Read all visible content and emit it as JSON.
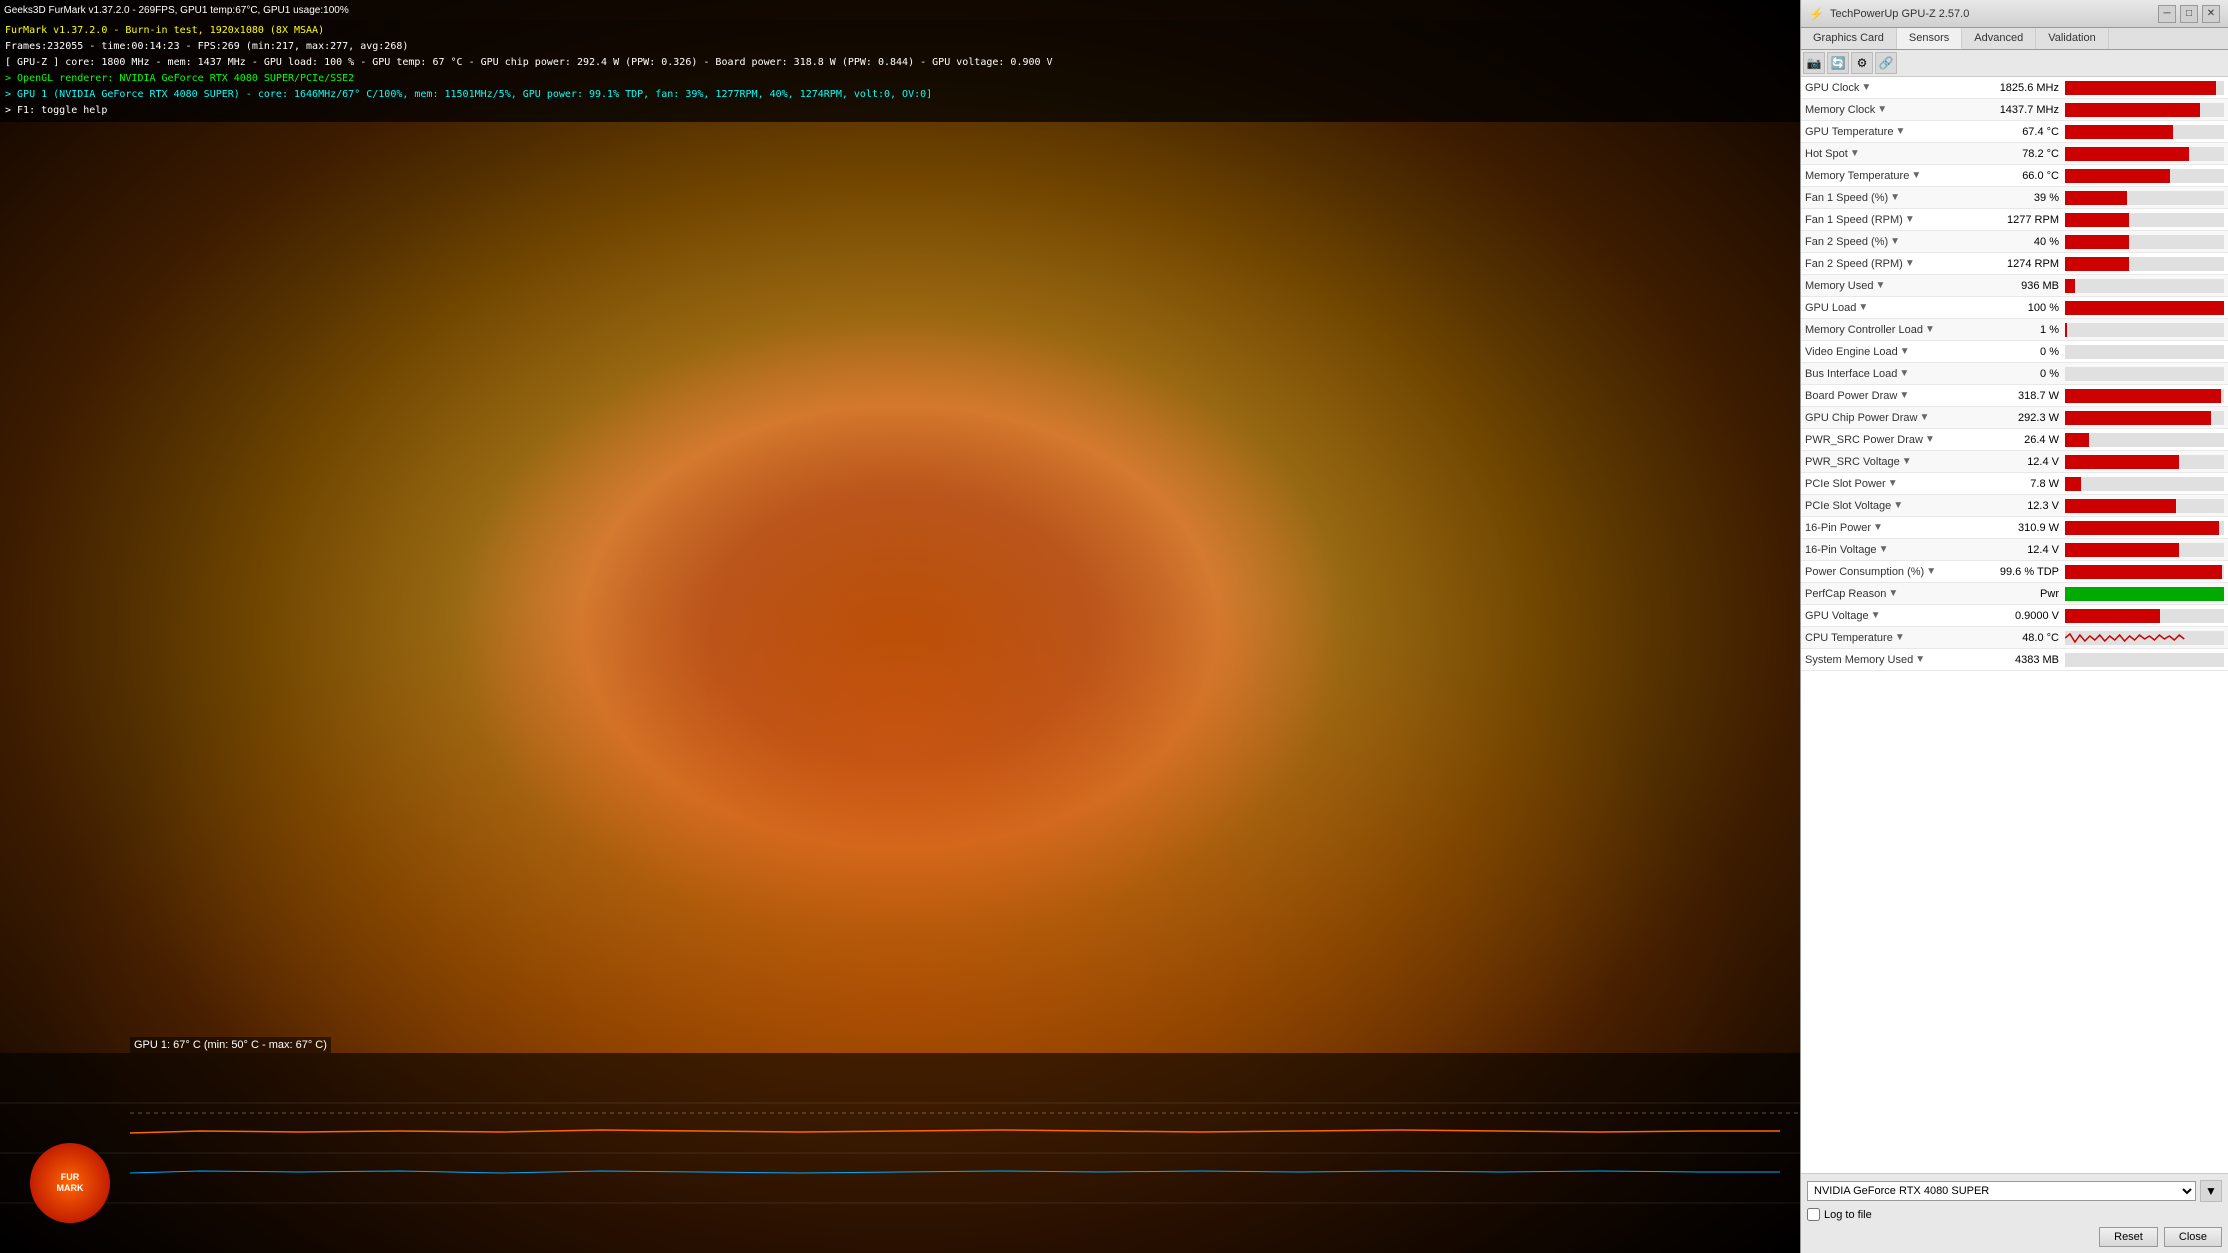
{
  "window": {
    "title": "Geeks3D FurMark v1.37.2.0 - 269FPS, GPU1 temp:67°C, GPU1 usage:100%"
  },
  "furmark": {
    "title": "FurMark v1.37.2.0 - Burn-in test, 1920x1080 (8X MSAA)",
    "stats_line1": "Frames:232055 - time:00:14:23 - FPS:269 (min:217, max:277, avg:268)",
    "stats_line2": "[ GPU-Z ] core: 1800 MHz - mem: 1437 MHz - GPU load: 100 % - GPU temp: 67 °C - GPU chip power: 292.4 W (PPW: 0.326) - Board power: 318.8 W (PPW: 0.844) - GPU voltage: 0.900 V",
    "stats_line3": "> OpenGL renderer: NVIDIA GeForce RTX 4080 SUPER/PCIe/SSE2",
    "stats_line4": "> GPU 1 (NVIDIA GeForce RTX 4080 SUPER) - core: 1646MHz/67° C/100%, mem: 11501MHz/5%, GPU power: 99.1% TDP, fan: 39%, 1277RPM, 40%, 1274RPM, volt:0, OV:0]",
    "stats_line5": "> F1: toggle help",
    "temp_label": "GPU 1: 67° C (min: 50° C - max: 67° C)"
  },
  "gpuz": {
    "title": "TechPowerUp GPU-Z 2.57.0",
    "tabs": [
      "Graphics Card",
      "Sensors",
      "Advanced",
      "Validation"
    ],
    "active_tab": "Sensors",
    "toolbar_buttons": [
      "camera",
      "refresh",
      "settings",
      "link"
    ],
    "sensors": [
      {
        "name": "GPU Clock",
        "value": "1825.6 MHz",
        "bar_pct": 95,
        "bar_color": "red"
      },
      {
        "name": "Memory Clock",
        "value": "1437.7 MHz",
        "bar_pct": 85,
        "bar_color": "red"
      },
      {
        "name": "GPU Temperature",
        "value": "67.4 °C",
        "bar_pct": 68,
        "bar_color": "red"
      },
      {
        "name": "Hot Spot",
        "value": "78.2 °C",
        "bar_pct": 78,
        "bar_color": "red"
      },
      {
        "name": "Memory Temperature",
        "value": "66.0 °C",
        "bar_pct": 66,
        "bar_color": "red"
      },
      {
        "name": "Fan 1 Speed (%)",
        "value": "39 %",
        "bar_pct": 39,
        "bar_color": "red"
      },
      {
        "name": "Fan 1 Speed (RPM)",
        "value": "1277 RPM",
        "bar_pct": 40,
        "bar_color": "red"
      },
      {
        "name": "Fan 2 Speed (%)",
        "value": "40 %",
        "bar_pct": 40,
        "bar_color": "red"
      },
      {
        "name": "Fan 2 Speed (RPM)",
        "value": "1274 RPM",
        "bar_pct": 40,
        "bar_color": "red"
      },
      {
        "name": "Memory Used",
        "value": "936 MB",
        "bar_pct": 6,
        "bar_color": "red"
      },
      {
        "name": "GPU Load",
        "value": "100 %",
        "bar_pct": 100,
        "bar_color": "red"
      },
      {
        "name": "Memory Controller Load",
        "value": "1 %",
        "bar_pct": 1,
        "bar_color": "red"
      },
      {
        "name": "Video Engine Load",
        "value": "0 %",
        "bar_pct": 0,
        "bar_color": "red"
      },
      {
        "name": "Bus Interface Load",
        "value": "0 %",
        "bar_pct": 0,
        "bar_color": "red"
      },
      {
        "name": "Board Power Draw",
        "value": "318.7 W",
        "bar_pct": 98,
        "bar_color": "red"
      },
      {
        "name": "GPU Chip Power Draw",
        "value": "292.3 W",
        "bar_pct": 92,
        "bar_color": "red"
      },
      {
        "name": "PWR_SRC Power Draw",
        "value": "26.4 W",
        "bar_pct": 15,
        "bar_color": "red"
      },
      {
        "name": "PWR_SRC Voltage",
        "value": "12.4 V",
        "bar_pct": 72,
        "bar_color": "red"
      },
      {
        "name": "PCIe Slot Power",
        "value": "7.8 W",
        "bar_pct": 10,
        "bar_color": "red"
      },
      {
        "name": "PCIe Slot Voltage",
        "value": "12.3 V",
        "bar_pct": 70,
        "bar_color": "red"
      },
      {
        "name": "16-Pin Power",
        "value": "310.9 W",
        "bar_pct": 97,
        "bar_color": "red"
      },
      {
        "name": "16-Pin Voltage",
        "value": "12.4 V",
        "bar_pct": 72,
        "bar_color": "red"
      },
      {
        "name": "Power Consumption (%)",
        "value": "99.6 % TDP",
        "bar_pct": 99,
        "bar_color": "red"
      },
      {
        "name": "PerfCap Reason",
        "value": "Pwr",
        "bar_pct": 100,
        "bar_color": "green"
      },
      {
        "name": "GPU Voltage",
        "value": "0.9000 V",
        "bar_pct": 60,
        "bar_color": "red"
      },
      {
        "name": "CPU Temperature",
        "value": "48.0 °C",
        "bar_pct": 30,
        "bar_color": "squiggly"
      },
      {
        "name": "System Memory Used",
        "value": "4383 MB",
        "bar_pct": 8,
        "bar_color": "none"
      }
    ],
    "log_to_file": "Log to file",
    "reset_button": "Reset",
    "close_button": "Close",
    "gpu_selector": "NVIDIA GeForce RTX 4080 SUPER"
  }
}
